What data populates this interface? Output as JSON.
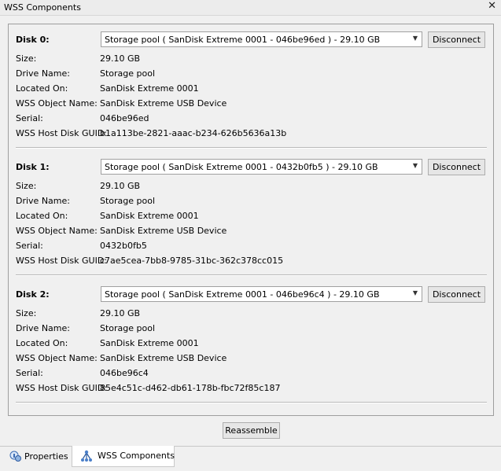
{
  "window": {
    "title": "WSS Components",
    "close_glyph": "✕"
  },
  "disks": [
    {
      "label": "Disk 0:",
      "selection": "Storage pool ( SanDisk Extreme 0001 - 046be96ed )  - 29.10 GB",
      "disconnect_label": "Disconnect",
      "fields": [
        {
          "label": "Size:",
          "value": "29.10 GB"
        },
        {
          "label": "Drive Name:",
          "value": "Storage pool"
        },
        {
          "label": "Located On:",
          "value": "SanDisk Extreme 0001"
        },
        {
          "label": "WSS Object Name:",
          "value": "SanDisk Extreme USB Device"
        },
        {
          "label": "Serial:",
          "value": "046be96ed"
        },
        {
          "label": "WSS Host Disk GUID:",
          "value": "b1a113be-2821-aaac-b234-626b5636a13b"
        }
      ]
    },
    {
      "label": "Disk 1:",
      "selection": "Storage pool ( SanDisk Extreme 0001 - 0432b0fb5 )  - 29.10 GB",
      "disconnect_label": "Disconnect",
      "fields": [
        {
          "label": "Size:",
          "value": "29.10 GB"
        },
        {
          "label": "Drive Name:",
          "value": "Storage pool"
        },
        {
          "label": "Located On:",
          "value": "SanDisk Extreme 0001"
        },
        {
          "label": "WSS Object Name:",
          "value": "SanDisk Extreme USB Device"
        },
        {
          "label": "Serial:",
          "value": "0432b0fb5"
        },
        {
          "label": "WSS Host Disk GUID:",
          "value": "c7ae5cea-7bb8-9785-31bc-362c378cc015"
        }
      ]
    },
    {
      "label": "Disk 2:",
      "selection": "Storage pool ( SanDisk Extreme 0001 - 046be96c4 )  - 29.10 GB",
      "disconnect_label": "Disconnect",
      "fields": [
        {
          "label": "Size:",
          "value": "29.10 GB"
        },
        {
          "label": "Drive Name:",
          "value": "Storage pool"
        },
        {
          "label": "Located On:",
          "value": "SanDisk Extreme 0001"
        },
        {
          "label": "WSS Object Name:",
          "value": "SanDisk Extreme USB Device"
        },
        {
          "label": "Serial:",
          "value": "046be96c4"
        },
        {
          "label": "WSS Host Disk GUID:",
          "value": "85e4c51c-d462-db61-178b-fbc72f85c187"
        }
      ]
    }
  ],
  "reassemble_label": "Reassemble",
  "tabs": [
    {
      "label": "Properties",
      "icon": "properties-icon",
      "active": false
    },
    {
      "label": "WSS Components",
      "icon": "network-tree-icon",
      "active": true
    }
  ]
}
